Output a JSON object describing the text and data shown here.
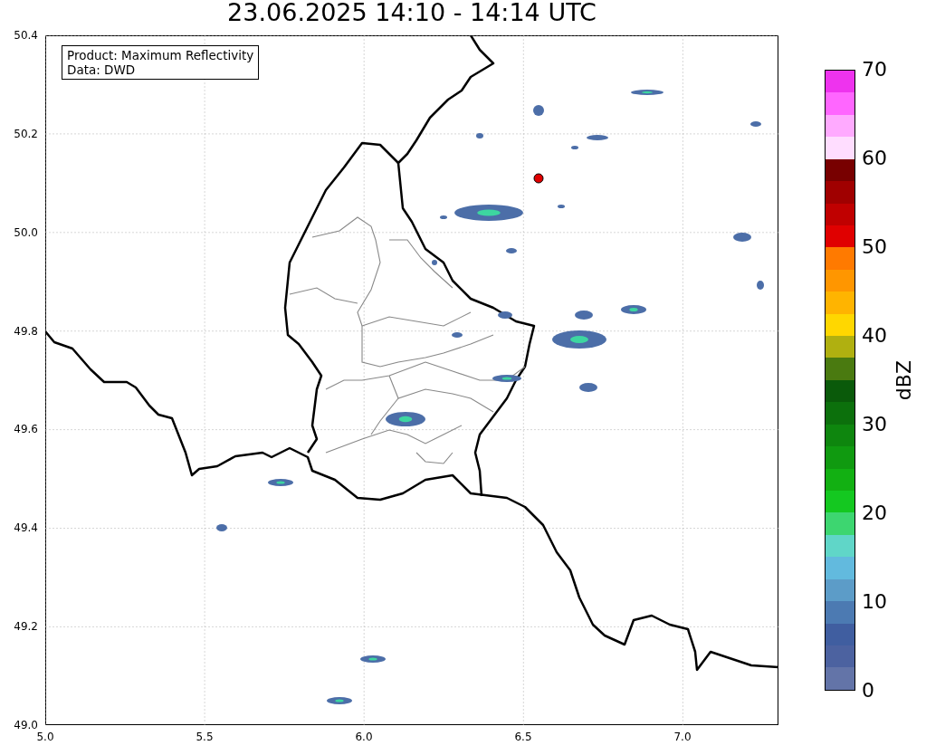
{
  "title": "23.06.2025 14:10 - 14:14 UTC",
  "info_box": [
    "Product: Maximum Reflectivity",
    "Data: DWD"
  ],
  "map": {
    "x_ticks": [
      "5.0",
      "5.5",
      "6.0",
      "6.5",
      "7.0"
    ],
    "y_ticks": [
      "50.4",
      "50.2",
      "50.0",
      "49.8",
      "49.6",
      "49.4",
      "49.2",
      "49.0"
    ]
  },
  "colorbar": {
    "label": "dBZ",
    "ticks": [
      "70",
      "60",
      "50",
      "40",
      "30",
      "20",
      "10",
      "0"
    ],
    "segments": [
      {
        "color": "#ee33ee"
      },
      {
        "color": "#ff66ff"
      },
      {
        "color": "#ffaaff"
      },
      {
        "color": "#ffddff"
      },
      {
        "color": "#780000"
      },
      {
        "color": "#a00000"
      },
      {
        "color": "#c00000"
      },
      {
        "color": "#e00000"
      },
      {
        "color": "#ff7a00"
      },
      {
        "color": "#ff9600"
      },
      {
        "color": "#ffb400"
      },
      {
        "color": "#ffd700"
      },
      {
        "color": "#b0b010"
      },
      {
        "color": "#4a7a10"
      },
      {
        "color": "#0a5a0a"
      },
      {
        "color": "#0c700c"
      },
      {
        "color": "#0e860e"
      },
      {
        "color": "#109a10"
      },
      {
        "color": "#12b012"
      },
      {
        "color": "#14c820"
      },
      {
        "color": "#3dd670"
      },
      {
        "color": "#60d6c8"
      },
      {
        "color": "#62bade"
      },
      {
        "color": "#5c9cc8"
      },
      {
        "color": "#4c7ab2"
      },
      {
        "color": "#405ea0"
      },
      {
        "color": "#4c62a0"
      },
      {
        "color": "#6374a8"
      }
    ]
  }
}
